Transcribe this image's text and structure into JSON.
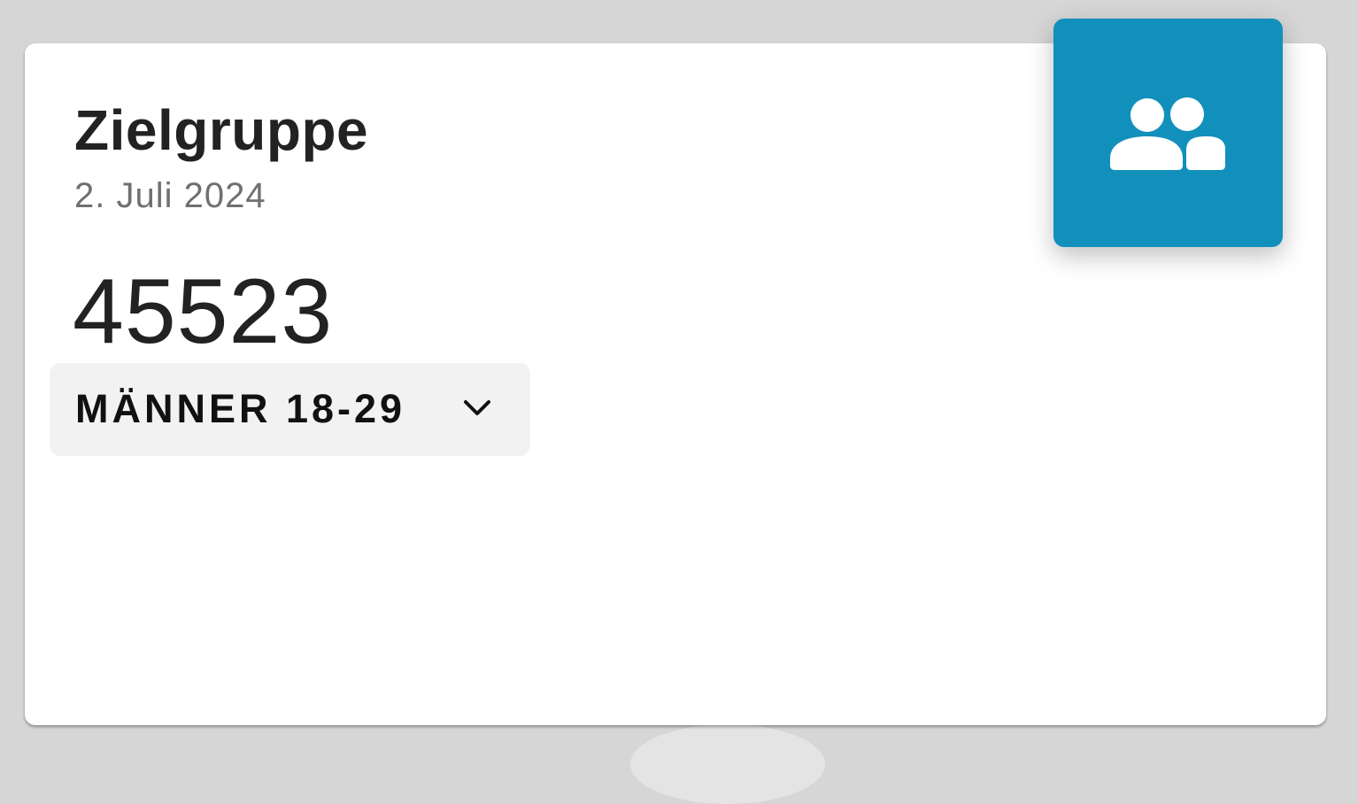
{
  "card": {
    "title": "Zielgruppe",
    "date": "2. Juli 2024",
    "metric_value": "45523",
    "target_group": {
      "selected": "MÄNNER 18-29"
    },
    "icon": "group-icon",
    "accent_color": "#1290bc"
  }
}
